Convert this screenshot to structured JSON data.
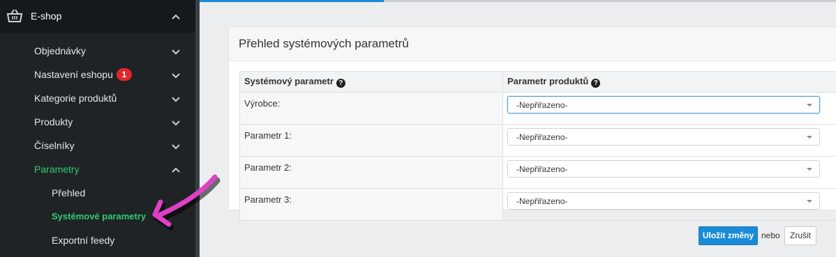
{
  "sidebar": {
    "header": {
      "title": "E-shop",
      "icon": "basket-icon"
    },
    "items": [
      {
        "label": "Objednávky"
      },
      {
        "label": "Nastavení eshopu",
        "badge": "1"
      },
      {
        "label": "Kategorie produktů"
      },
      {
        "label": "Produkty"
      },
      {
        "label": "Číselníky"
      },
      {
        "label": "Parametry",
        "expanded": true
      }
    ],
    "subitems": [
      {
        "label": "Přehled"
      },
      {
        "label": "Systémové parametry",
        "active": true
      },
      {
        "label": "Exportní feedy"
      }
    ]
  },
  "top_progress": {
    "fraction": 0.29,
    "color": "#1a8bd6"
  },
  "panel": {
    "title": "Přehled systémových parametrů",
    "columns": [
      "Systémový parametr",
      "Parametr produktů"
    ],
    "rows": [
      {
        "label": "Výrobce:",
        "value": "-Nepřiřazeno-"
      },
      {
        "label": "Parametr 1:",
        "value": "-Nepřiřazeno-"
      },
      {
        "label": "Parametr 2:",
        "value": "-Nepřiřazeno-"
      },
      {
        "label": "Parametr 3:",
        "value": "-Nepřiřazeno-"
      }
    ]
  },
  "footer": {
    "save_label": "Uložit změny",
    "or_label": "nebo",
    "cancel_label": "Zrušit"
  },
  "colors": {
    "accent": "#1a8bd6",
    "active_green": "#2ecc71",
    "badge_red": "#e0262b",
    "annotation_arrow": "#e040c8"
  }
}
